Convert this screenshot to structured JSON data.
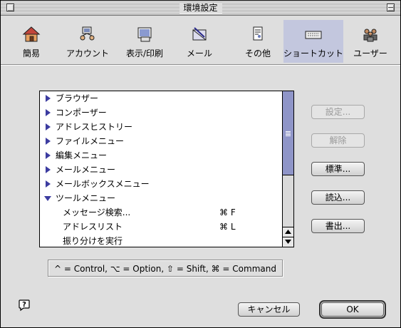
{
  "window": {
    "title": "環境設定"
  },
  "toolbar": {
    "items": [
      {
        "label": "簡易",
        "icon": "house-icon",
        "selected": false
      },
      {
        "label": "アカウント",
        "icon": "account-icon",
        "selected": false
      },
      {
        "label": "表示/印刷",
        "icon": "display-print-icon",
        "selected": false
      },
      {
        "label": "メール",
        "icon": "mail-icon",
        "selected": false
      },
      {
        "label": "その他",
        "icon": "other-icon",
        "selected": false
      },
      {
        "label": "ショートカット",
        "icon": "keyboard-icon",
        "selected": true
      },
      {
        "label": "ユーザー",
        "icon": "users-icon",
        "selected": false
      }
    ]
  },
  "list": {
    "rows": [
      {
        "label": "ブラウザー",
        "expanded": false,
        "child": false,
        "key": ""
      },
      {
        "label": "コンポーザー",
        "expanded": false,
        "child": false,
        "key": ""
      },
      {
        "label": "アドレスヒストリー",
        "expanded": false,
        "child": false,
        "key": ""
      },
      {
        "label": "ファイルメニュー",
        "expanded": false,
        "child": false,
        "key": ""
      },
      {
        "label": "編集メニュー",
        "expanded": false,
        "child": false,
        "key": ""
      },
      {
        "label": "メールメニュー",
        "expanded": false,
        "child": false,
        "key": ""
      },
      {
        "label": "メールボックスメニュー",
        "expanded": false,
        "child": false,
        "key": ""
      },
      {
        "label": "ツールメニュー",
        "expanded": true,
        "child": false,
        "key": ""
      },
      {
        "label": "メッセージ検索...",
        "child": true,
        "key": "⌘ F"
      },
      {
        "label": "アドレスリスト",
        "child": true,
        "key": "⌘ L"
      },
      {
        "label": "振り分けを実行",
        "child": true,
        "key": ""
      }
    ]
  },
  "buttons": {
    "set": "設定...",
    "clear": "解除",
    "standard": "標準...",
    "import": "読込...",
    "export": "書出...",
    "cancel": "キャンセル",
    "ok": "OK"
  },
  "legend": "^ = Control, ⌥ = Option, ⇧ = Shift, ⌘ = Command",
  "colors": {
    "selection": "#c3c7de",
    "scroll_thumb": "#8f95c8",
    "triangle": "#3c3ca0"
  }
}
